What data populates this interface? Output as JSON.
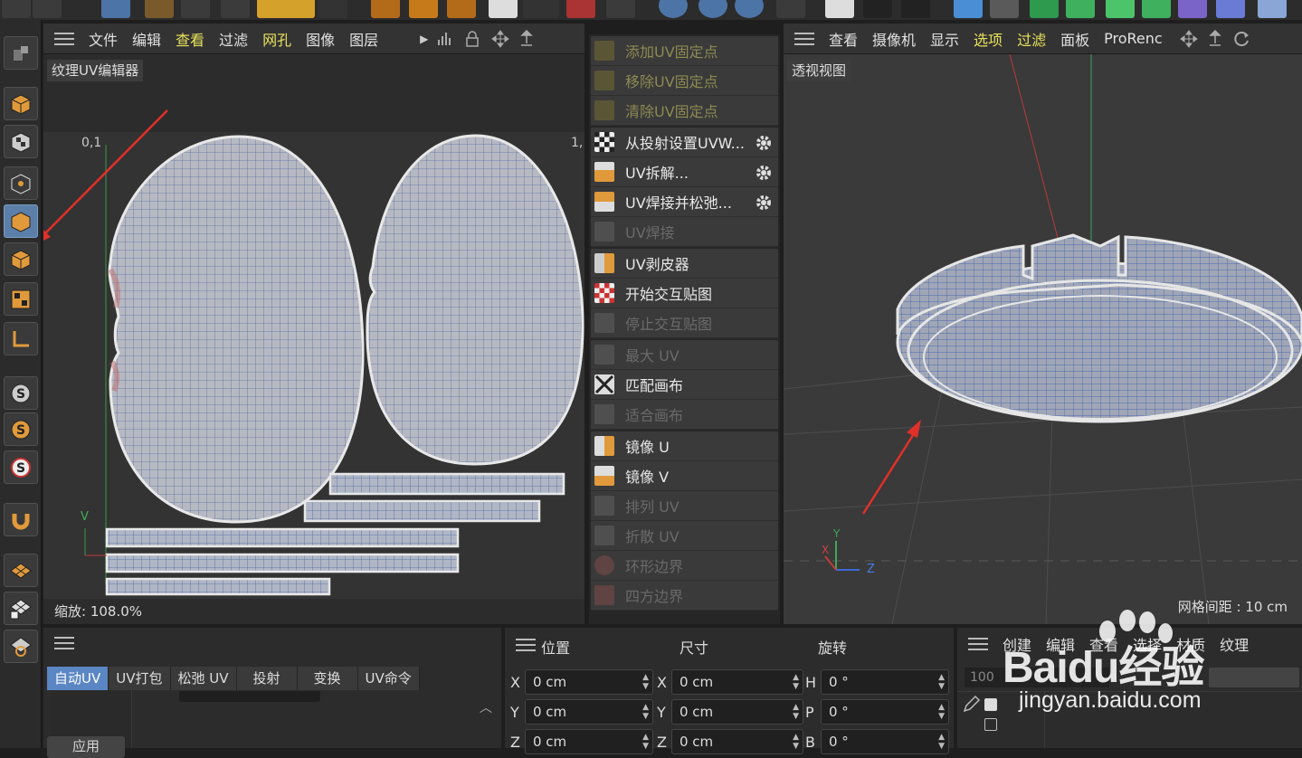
{
  "uv_editor": {
    "menu": [
      "文件",
      "编辑",
      "查看",
      "过滤",
      "网孔",
      "图像",
      "图层"
    ],
    "highlight_menu": [
      "查看",
      "网孔"
    ],
    "label": "纹理UV编辑器",
    "coord_left": "0,1",
    "coord_right": "1,",
    "axis_v": "V",
    "zoom": "缩放: 108.0%"
  },
  "commands": {
    "group1": [
      "添加UV固定点",
      "移除UV固定点",
      "清除UV固定点"
    ],
    "group2": [
      "从投射设置UVW...",
      "UV拆解...",
      "UV焊接并松弛...",
      "UV焊接"
    ],
    "group3": [
      "UV剥皮器",
      "开始交互贴图",
      "停止交互贴图"
    ],
    "group4": [
      "最大 UV",
      "匹配画布",
      "适合画布"
    ],
    "group5": [
      "镜像 U",
      "镜像 V",
      "排列 UV",
      "折散 UV",
      "环形边界",
      "四方边界"
    ]
  },
  "viewport": {
    "menu": [
      "查看",
      "摄像机",
      "显示",
      "选项",
      "过滤",
      "面板",
      "ProRenc"
    ],
    "highlight_menu": [
      "选项",
      "过滤"
    ],
    "label": "透视视图",
    "grid": "网格间距 : 10 cm",
    "axis_y": "Y",
    "axis_x": "X",
    "axis_z": "Z"
  },
  "uv_tabs": {
    "tabs": [
      "自动UV",
      "UV打包",
      "松弛 UV",
      "投射",
      "变换",
      "UV命令"
    ],
    "active": "自动UV",
    "apply": "应用"
  },
  "coords": {
    "headers": [
      "位置",
      "尺寸",
      "旋转"
    ],
    "rows": [
      {
        "a": "X",
        "av": "0 cm",
        "b": "X",
        "bv": "0 cm",
        "c": "H",
        "cv": "0 °"
      },
      {
        "a": "Y",
        "av": "0 cm",
        "b": "Y",
        "bv": "0 cm",
        "c": "P",
        "cv": "0 °"
      },
      {
        "a": "Z",
        "av": "0 cm",
        "b": "Z",
        "bv": "0 cm",
        "c": "B",
        "cv": "0 °"
      }
    ]
  },
  "materials": {
    "menu": [
      "创建",
      "编辑",
      "查看",
      "选择",
      "材质",
      "纹理"
    ],
    "value": "100"
  },
  "watermark": {
    "brand": "Baidu经验",
    "url": "jingyan.baidu.com"
  },
  "colors": {
    "accent": "#5b86c4",
    "highlight_text": "#e8e25b",
    "mesh": "#9aa2b4",
    "arrow": "#e0302a"
  }
}
